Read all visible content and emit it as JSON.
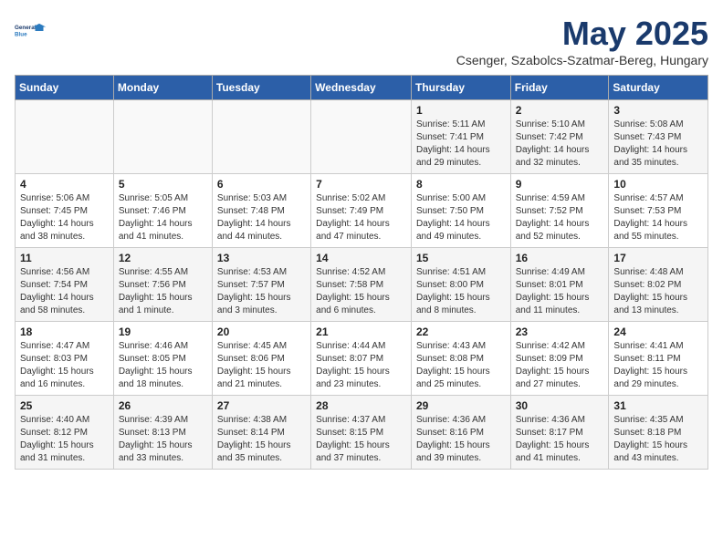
{
  "header": {
    "logo_line1": "General",
    "logo_line2": "Blue",
    "month": "May 2025",
    "location": "Csenger, Szabolcs-Szatmar-Bereg, Hungary"
  },
  "weekdays": [
    "Sunday",
    "Monday",
    "Tuesday",
    "Wednesday",
    "Thursday",
    "Friday",
    "Saturday"
  ],
  "weeks": [
    [
      {
        "day": "",
        "info": ""
      },
      {
        "day": "",
        "info": ""
      },
      {
        "day": "",
        "info": ""
      },
      {
        "day": "",
        "info": ""
      },
      {
        "day": "1",
        "info": "Sunrise: 5:11 AM\nSunset: 7:41 PM\nDaylight: 14 hours\nand 29 minutes."
      },
      {
        "day": "2",
        "info": "Sunrise: 5:10 AM\nSunset: 7:42 PM\nDaylight: 14 hours\nand 32 minutes."
      },
      {
        "day": "3",
        "info": "Sunrise: 5:08 AM\nSunset: 7:43 PM\nDaylight: 14 hours\nand 35 minutes."
      }
    ],
    [
      {
        "day": "4",
        "info": "Sunrise: 5:06 AM\nSunset: 7:45 PM\nDaylight: 14 hours\nand 38 minutes."
      },
      {
        "day": "5",
        "info": "Sunrise: 5:05 AM\nSunset: 7:46 PM\nDaylight: 14 hours\nand 41 minutes."
      },
      {
        "day": "6",
        "info": "Sunrise: 5:03 AM\nSunset: 7:48 PM\nDaylight: 14 hours\nand 44 minutes."
      },
      {
        "day": "7",
        "info": "Sunrise: 5:02 AM\nSunset: 7:49 PM\nDaylight: 14 hours\nand 47 minutes."
      },
      {
        "day": "8",
        "info": "Sunrise: 5:00 AM\nSunset: 7:50 PM\nDaylight: 14 hours\nand 49 minutes."
      },
      {
        "day": "9",
        "info": "Sunrise: 4:59 AM\nSunset: 7:52 PM\nDaylight: 14 hours\nand 52 minutes."
      },
      {
        "day": "10",
        "info": "Sunrise: 4:57 AM\nSunset: 7:53 PM\nDaylight: 14 hours\nand 55 minutes."
      }
    ],
    [
      {
        "day": "11",
        "info": "Sunrise: 4:56 AM\nSunset: 7:54 PM\nDaylight: 14 hours\nand 58 minutes."
      },
      {
        "day": "12",
        "info": "Sunrise: 4:55 AM\nSunset: 7:56 PM\nDaylight: 15 hours\nand 1 minute."
      },
      {
        "day": "13",
        "info": "Sunrise: 4:53 AM\nSunset: 7:57 PM\nDaylight: 15 hours\nand 3 minutes."
      },
      {
        "day": "14",
        "info": "Sunrise: 4:52 AM\nSunset: 7:58 PM\nDaylight: 15 hours\nand 6 minutes."
      },
      {
        "day": "15",
        "info": "Sunrise: 4:51 AM\nSunset: 8:00 PM\nDaylight: 15 hours\nand 8 minutes."
      },
      {
        "day": "16",
        "info": "Sunrise: 4:49 AM\nSunset: 8:01 PM\nDaylight: 15 hours\nand 11 minutes."
      },
      {
        "day": "17",
        "info": "Sunrise: 4:48 AM\nSunset: 8:02 PM\nDaylight: 15 hours\nand 13 minutes."
      }
    ],
    [
      {
        "day": "18",
        "info": "Sunrise: 4:47 AM\nSunset: 8:03 PM\nDaylight: 15 hours\nand 16 minutes."
      },
      {
        "day": "19",
        "info": "Sunrise: 4:46 AM\nSunset: 8:05 PM\nDaylight: 15 hours\nand 18 minutes."
      },
      {
        "day": "20",
        "info": "Sunrise: 4:45 AM\nSunset: 8:06 PM\nDaylight: 15 hours\nand 21 minutes."
      },
      {
        "day": "21",
        "info": "Sunrise: 4:44 AM\nSunset: 8:07 PM\nDaylight: 15 hours\nand 23 minutes."
      },
      {
        "day": "22",
        "info": "Sunrise: 4:43 AM\nSunset: 8:08 PM\nDaylight: 15 hours\nand 25 minutes."
      },
      {
        "day": "23",
        "info": "Sunrise: 4:42 AM\nSunset: 8:09 PM\nDaylight: 15 hours\nand 27 minutes."
      },
      {
        "day": "24",
        "info": "Sunrise: 4:41 AM\nSunset: 8:11 PM\nDaylight: 15 hours\nand 29 minutes."
      }
    ],
    [
      {
        "day": "25",
        "info": "Sunrise: 4:40 AM\nSunset: 8:12 PM\nDaylight: 15 hours\nand 31 minutes."
      },
      {
        "day": "26",
        "info": "Sunrise: 4:39 AM\nSunset: 8:13 PM\nDaylight: 15 hours\nand 33 minutes."
      },
      {
        "day": "27",
        "info": "Sunrise: 4:38 AM\nSunset: 8:14 PM\nDaylight: 15 hours\nand 35 minutes."
      },
      {
        "day": "28",
        "info": "Sunrise: 4:37 AM\nSunset: 8:15 PM\nDaylight: 15 hours\nand 37 minutes."
      },
      {
        "day": "29",
        "info": "Sunrise: 4:36 AM\nSunset: 8:16 PM\nDaylight: 15 hours\nand 39 minutes."
      },
      {
        "day": "30",
        "info": "Sunrise: 4:36 AM\nSunset: 8:17 PM\nDaylight: 15 hours\nand 41 minutes."
      },
      {
        "day": "31",
        "info": "Sunrise: 4:35 AM\nSunset: 8:18 PM\nDaylight: 15 hours\nand 43 minutes."
      }
    ]
  ]
}
